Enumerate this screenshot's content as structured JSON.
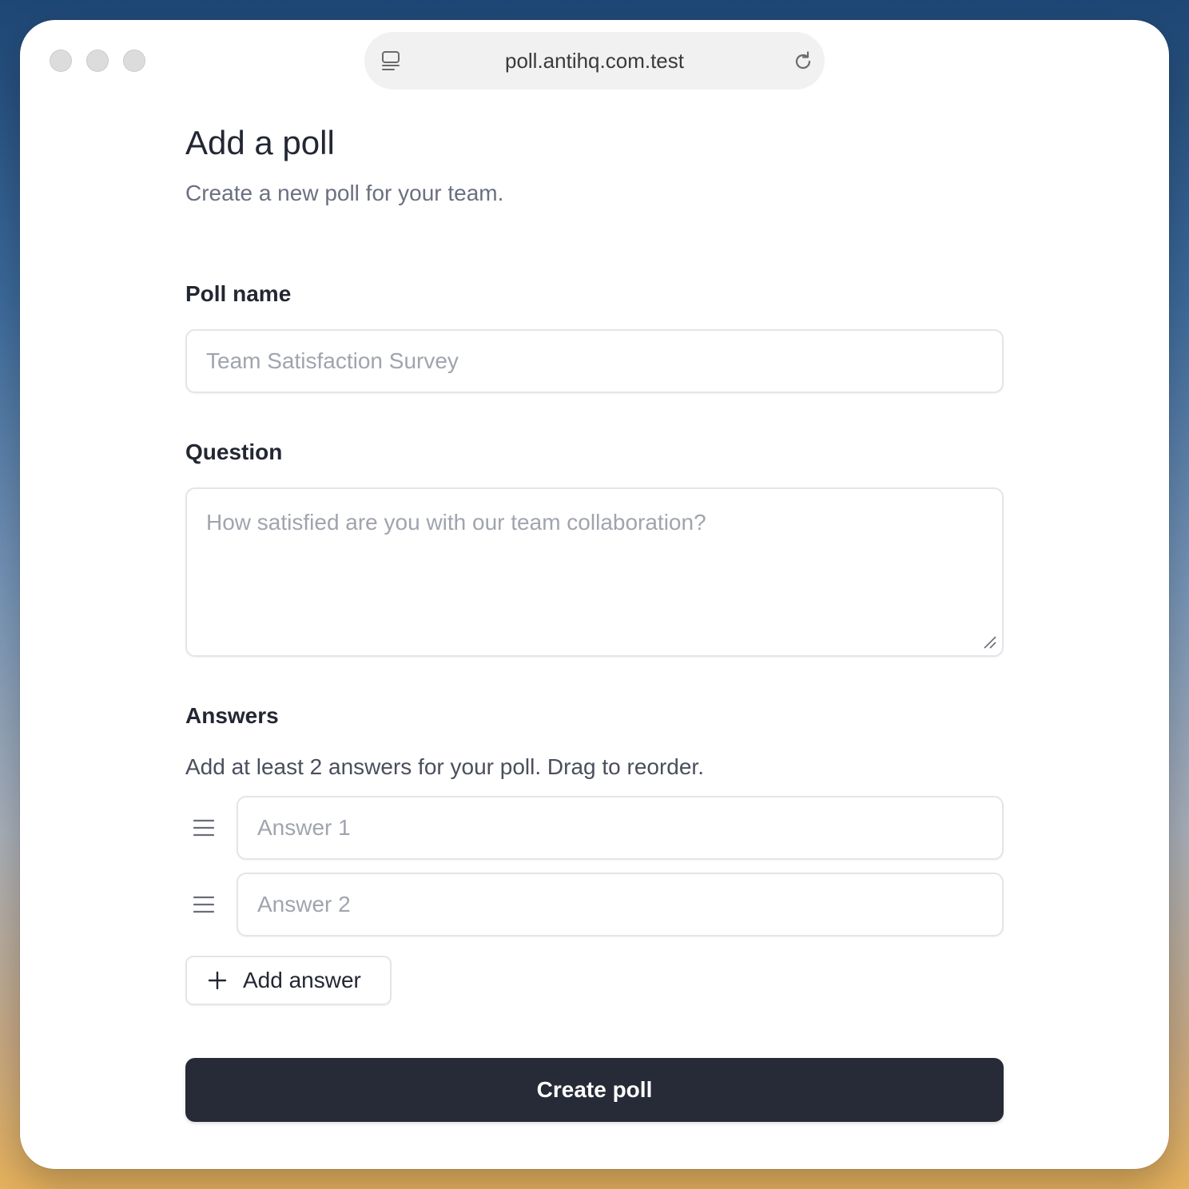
{
  "browser": {
    "url": "poll.antihq.com.test",
    "icons": [
      "tab-overview-icon",
      "reload-icon"
    ]
  },
  "page": {
    "title": "Add a poll",
    "subtitle": "Create a new poll for your team."
  },
  "form": {
    "poll_name": {
      "label": "Poll name",
      "value": "",
      "placeholder": "Team Satisfaction Survey"
    },
    "question": {
      "label": "Question",
      "value": "",
      "placeholder": "How satisfied are you with our team collaboration?"
    },
    "answers": {
      "label": "Answers",
      "helper": "Add at least 2 answers for your poll. Drag to reorder.",
      "items": [
        {
          "value": "",
          "placeholder": "Answer 1"
        },
        {
          "value": "",
          "placeholder": "Answer 2"
        }
      ],
      "add_label": "Add answer"
    },
    "submit_label": "Create poll"
  },
  "colors": {
    "primary_button": "#272b37",
    "text": "#232733",
    "muted_text": "#6b7080",
    "placeholder": "#a0a4ad",
    "border": "#e3e5e9"
  }
}
